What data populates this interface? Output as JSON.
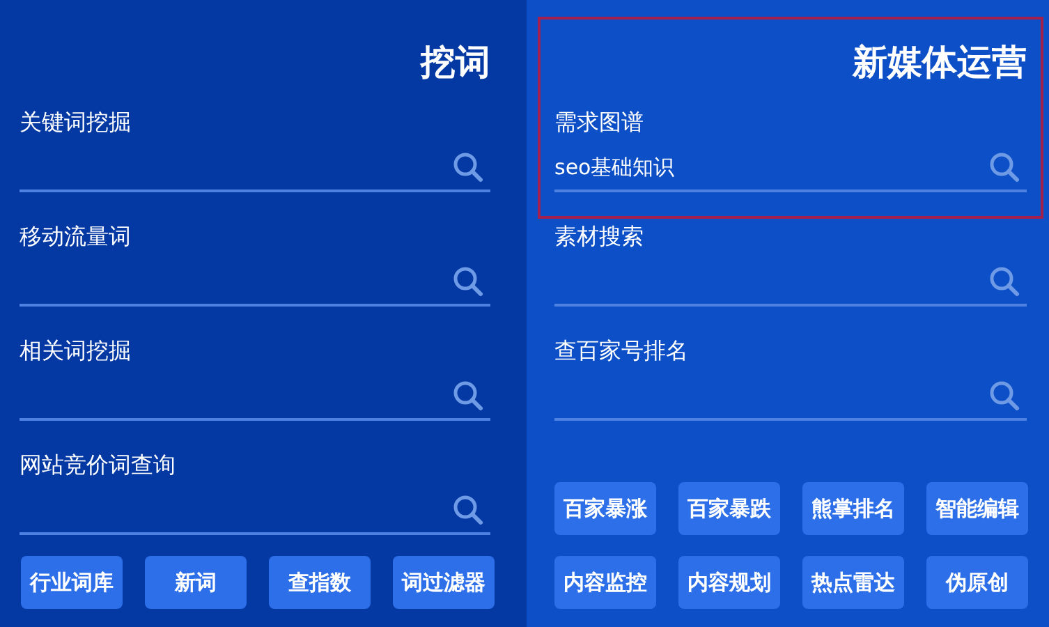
{
  "panels": [
    {
      "title": "挖词",
      "highlighted": false,
      "fields": [
        {
          "label": "关键词挖掘"
        },
        {
          "label": "移动流量词"
        },
        {
          "label": "相关词挖掘"
        },
        {
          "label": "网站竞价词查询"
        }
      ],
      "buttons": [
        "行业词库",
        "新词",
        "查指数",
        "词过滤器"
      ]
    },
    {
      "title": "新媒体运营",
      "highlighted": true,
      "fields": [
        {
          "label": "需求图谱",
          "value": "seo基础知识"
        },
        {
          "label": "素材搜索"
        },
        {
          "label": "查百家号排名"
        }
      ],
      "buttons": [
        "百家暴涨",
        "百家暴跌",
        "熊掌排名",
        "智能编辑",
        "内容监控",
        "内容规划",
        "热点雷达",
        "伪原创"
      ]
    }
  ]
}
